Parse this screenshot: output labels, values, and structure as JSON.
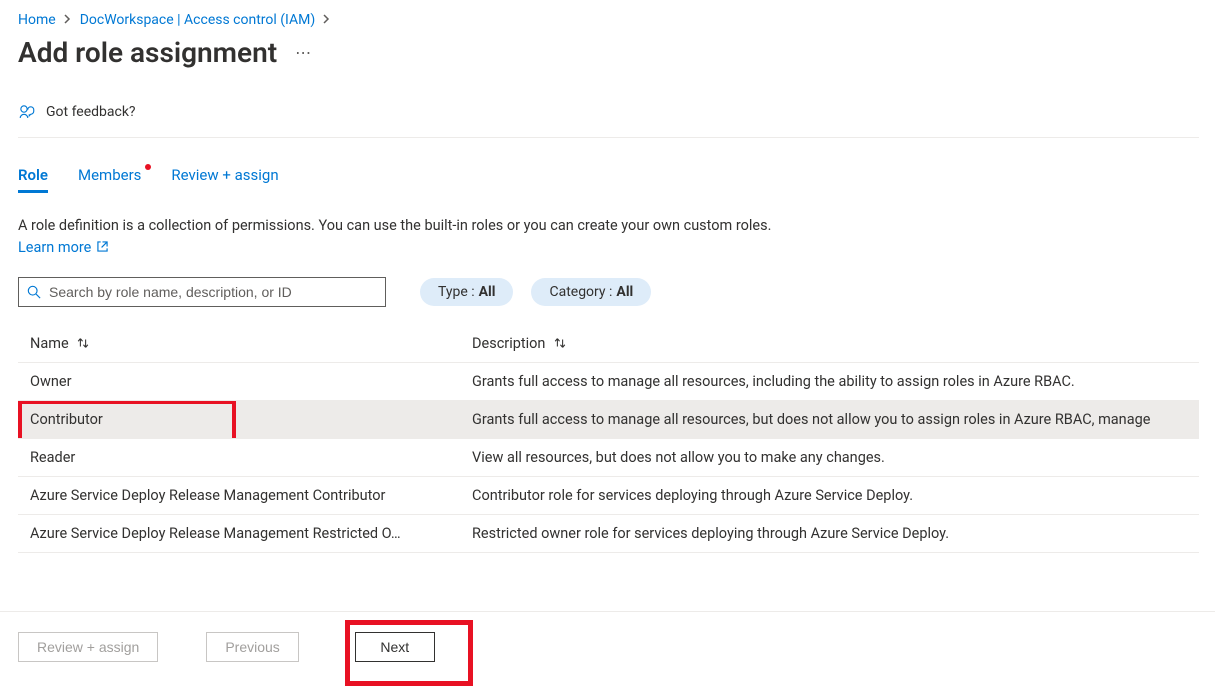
{
  "breadcrumb": {
    "home": "Home",
    "workspace": "DocWorkspace | Access control (IAM)"
  },
  "title": "Add role assignment",
  "feedback_label": "Got feedback?",
  "tabs": {
    "role": "Role",
    "members": "Members",
    "review": "Review + assign"
  },
  "description_text": "A role definition is a collection of permissions. You can use the built-in roles or you can create your own custom roles. ",
  "learn_more": "Learn more",
  "search_placeholder": "Search by role name, description, or ID",
  "filters": {
    "type_label": "Type : ",
    "type_value": "All",
    "category_label": "Category : ",
    "category_value": "All"
  },
  "columns": {
    "name": "Name",
    "description": "Description"
  },
  "roles": [
    {
      "name": "Owner",
      "description": "Grants full access to manage all resources, including the ability to assign roles in Azure RBAC."
    },
    {
      "name": "Contributor",
      "description": "Grants full access to manage all resources, but does not allow you to assign roles in Azure RBAC, manage"
    },
    {
      "name": "Reader",
      "description": "View all resources, but does not allow you to make any changes."
    },
    {
      "name": "Azure Service Deploy Release Management Contributor",
      "description": "Contributor role for services deploying through Azure Service Deploy."
    },
    {
      "name": "Azure Service Deploy Release Management Restricted O…",
      "description": "Restricted owner role for services deploying through Azure Service Deploy."
    }
  ],
  "buttons": {
    "review": "Review + assign",
    "previous": "Previous",
    "next": "Next"
  }
}
